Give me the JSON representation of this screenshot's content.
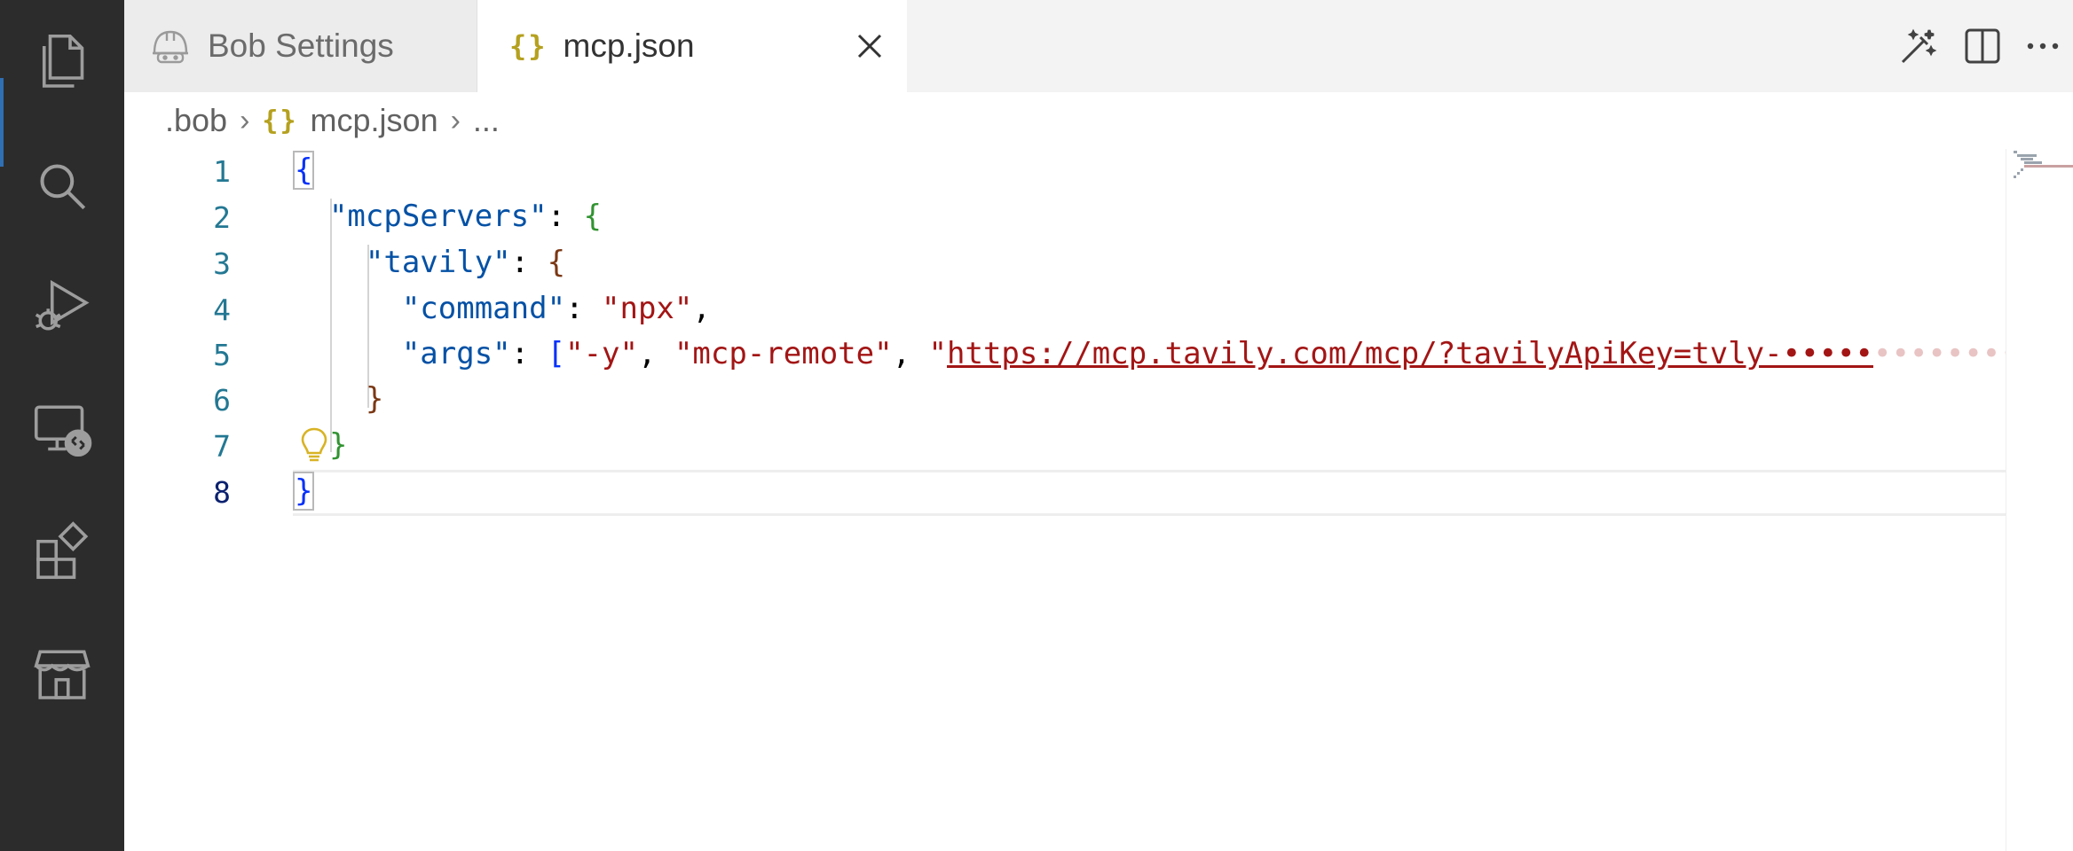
{
  "tabs": [
    {
      "label": "Bob Settings",
      "icon": "helmet-icon",
      "active": false
    },
    {
      "label": "mcp.json",
      "icon": "json-braces-icon",
      "active": true
    }
  ],
  "tab_icon_glyph": "{}",
  "breadcrumb": {
    "folder": ".bob",
    "file": "mcp.json",
    "ellipsis": "..."
  },
  "editor": {
    "line_numbers": [
      "1",
      "2",
      "3",
      "4",
      "5",
      "6",
      "7",
      "8"
    ],
    "active_line": 8,
    "code": {
      "l1_brace": "{",
      "l2_key": "\"mcpServers\"",
      "l3_key": "\"tavily\"",
      "l4_key": "\"command\"",
      "l4_val": "\"npx\"",
      "l5_key": "\"args\"",
      "l5_v1": "\"-y\"",
      "l5_v2": "\"mcp-remote\"",
      "l5_v3_quote": "\"",
      "l5_v3_url": "https://mcp.tavily.com/mcp/?tavilyApiKey=tvly-•••••",
      "l5_v3_faded": "••••••••••••",
      "l6_brace": "}",
      "l7_brace": "}",
      "l8_brace": "}"
    }
  },
  "colors": {
    "activity_bar": "#2c2c2c",
    "key": "#0451a5",
    "string": "#a31515",
    "bracket_level1": "#0431fa",
    "bracket_level2": "#319331",
    "bracket_level3": "#7b3814",
    "json_icon": "#b5a11f"
  }
}
